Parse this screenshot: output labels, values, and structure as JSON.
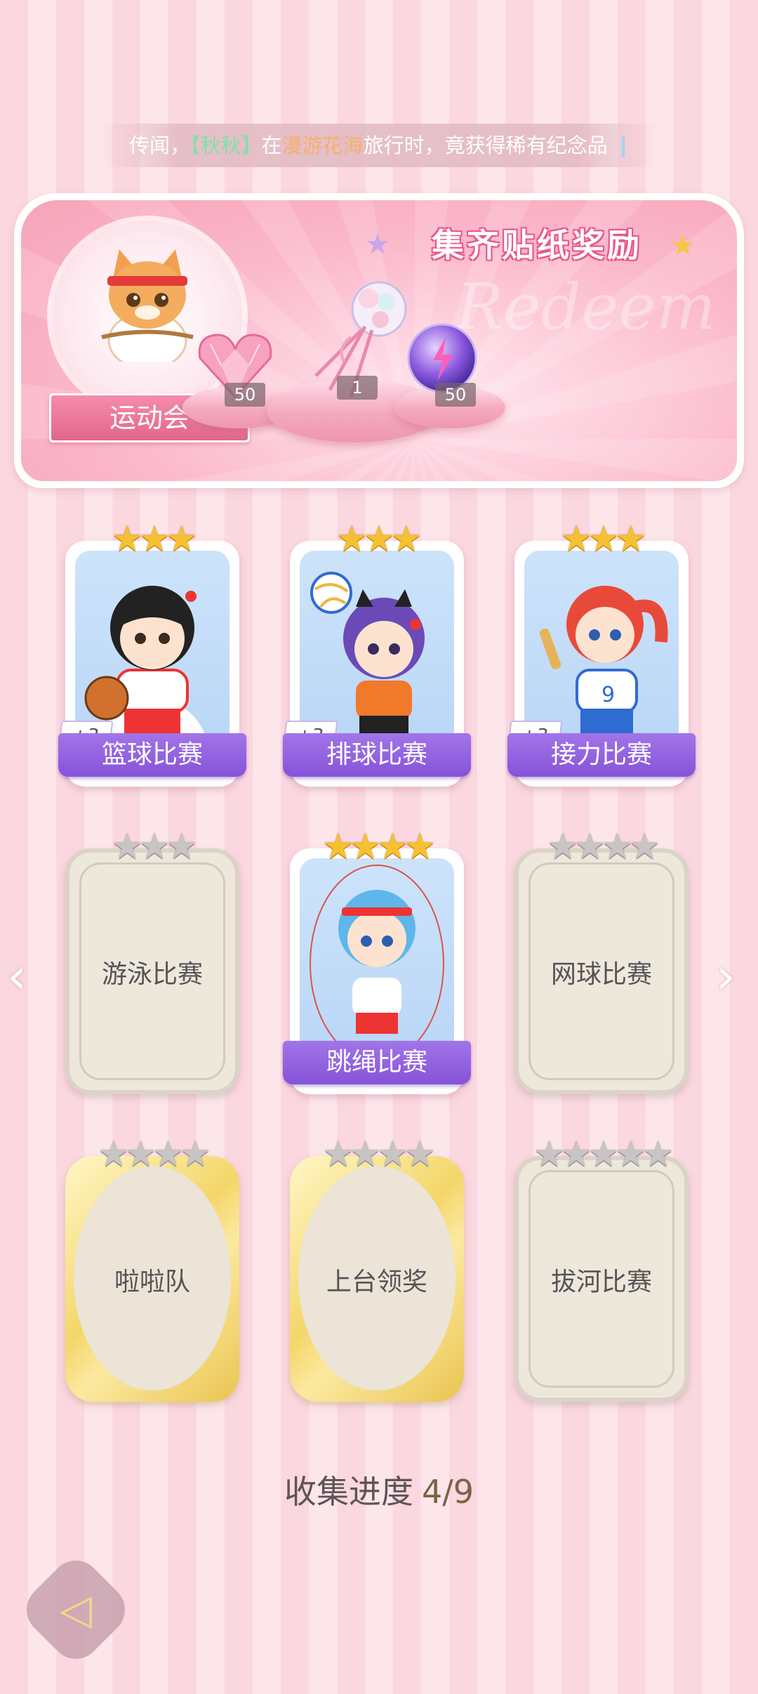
{
  "ticker": {
    "prefix": "传闻，",
    "player": "【秋秋】",
    "in": "在",
    "place": "漫游花海",
    "suffix": "旅行时，竟获得稀有纪念品"
  },
  "banner": {
    "title": "集齐贴纸奖励",
    "watermark": "Redeem",
    "event_label": "运动会",
    "rewards": [
      {
        "icon": "heart-gem-icon",
        "count": "50"
      },
      {
        "icon": "bouquet-icon",
        "count": "1"
      },
      {
        "icon": "purple-orb-icon",
        "count": "50"
      }
    ]
  },
  "stickers": [
    {
      "name": "篮球比赛",
      "collected": true,
      "stars": 3,
      "plus": "+3"
    },
    {
      "name": "排球比赛",
      "collected": true,
      "stars": 3,
      "plus": "+3"
    },
    {
      "name": "接力比赛",
      "collected": true,
      "stars": 3,
      "plus": "+3"
    },
    {
      "name": "游泳比赛",
      "collected": false,
      "stars": 3
    },
    {
      "name": "跳绳比赛",
      "collected": true,
      "stars": 4
    },
    {
      "name": "网球比赛",
      "collected": false,
      "stars": 4
    },
    {
      "name": "啦啦队",
      "collected": false,
      "stars": 4
    },
    {
      "name": "上台领奖",
      "collected": false,
      "stars": 4
    },
    {
      "name": "拔河比赛",
      "collected": false,
      "stars": 5
    }
  ],
  "progress": {
    "label": "收集进度",
    "value": "4/9"
  },
  "colors": {
    "accent": "#8553d9",
    "banner_pink": "#f7a3b9",
    "star_gold": "#f5c133"
  }
}
